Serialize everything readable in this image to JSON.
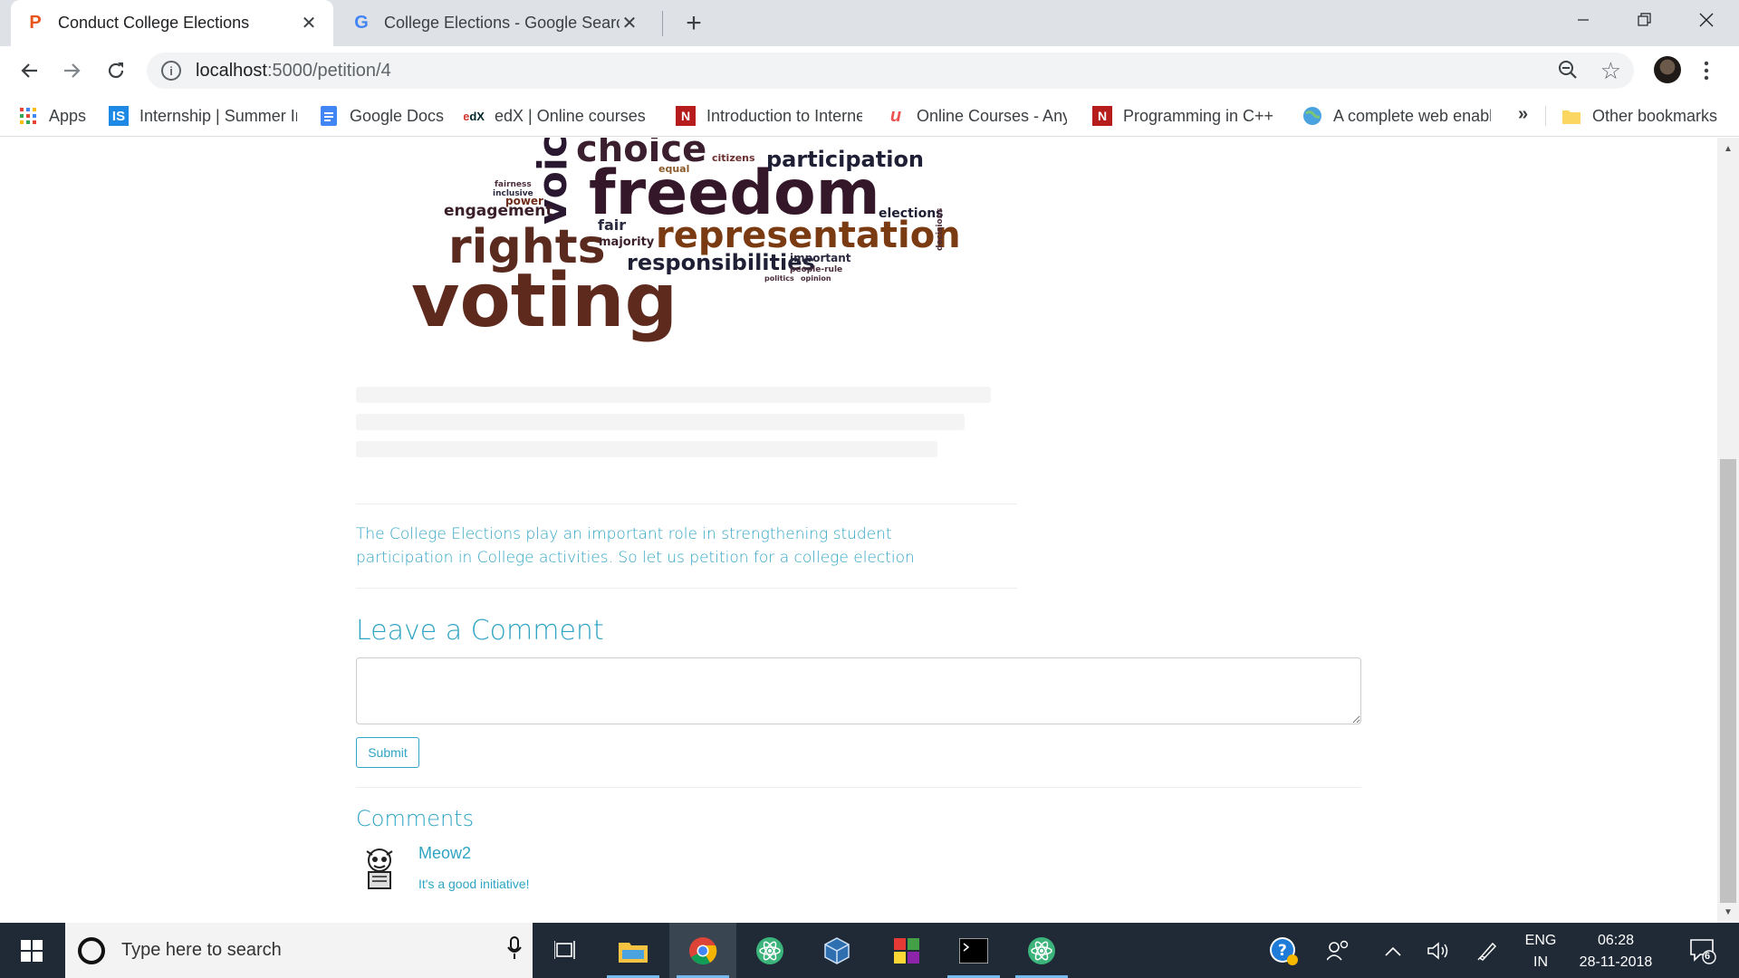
{
  "browser": {
    "tabs": [
      {
        "title": "Conduct College Elections",
        "favicon": "P",
        "favicon_color": "#e8561b",
        "active": true
      },
      {
        "title": "College Elections - Google Search",
        "favicon": "G",
        "favicon_color": "#4285f4",
        "active": false
      }
    ],
    "url_host": "localhost",
    "url_path": ":5000/petition/4"
  },
  "bookmarks": [
    {
      "label": "Apps",
      "icon": "apps-grid-icon"
    },
    {
      "label": "Internship | Summer Internship",
      "icon": "internshala-icon"
    },
    {
      "label": "Google Docs",
      "icon": "google-docs-icon"
    },
    {
      "label": "edX | Online courses",
      "icon": "edx-icon"
    },
    {
      "label": "Introduction to Internet",
      "icon": "nptel-icon"
    },
    {
      "label": "Online Courses - Anytime",
      "icon": "udemy-icon"
    },
    {
      "label": "Programming in C++",
      "icon": "nptel-icon"
    },
    {
      "label": "A complete web enabled",
      "icon": "globe-icon"
    },
    {
      "label": "Other bookmarks",
      "icon": "folder-icon"
    }
  ],
  "wordcloud": {
    "words": [
      "choice",
      "voice",
      "participation",
      "citizens",
      "equal",
      "fairness",
      "inclusive",
      "power",
      "engagement",
      "freedom",
      "elections",
      "rights",
      "fair",
      "majority",
      "representation",
      "decisions",
      "responsibilities",
      "important",
      "people-rule",
      "politics",
      "opinion",
      "voting"
    ]
  },
  "petition": {
    "description": "The College Elections play an important role in strengthening student participation in College activities. So let us petition for a college election"
  },
  "comment_form": {
    "title": "Leave a Comment",
    "textarea_value": "",
    "submit_label": "Submit"
  },
  "comments": {
    "title": "Comments",
    "items": [
      {
        "user": "Meow2",
        "text": "It's a good initiative!"
      }
    ]
  },
  "taskbar": {
    "search_placeholder": "Type here to search",
    "lang_line1": "ENG",
    "lang_line2": "IN",
    "time": "06:28",
    "date": "28-11-2018",
    "notification_count": "6"
  },
  "colors": {
    "accent": "#2fa4c4",
    "taskbar": "#1f2a36"
  }
}
